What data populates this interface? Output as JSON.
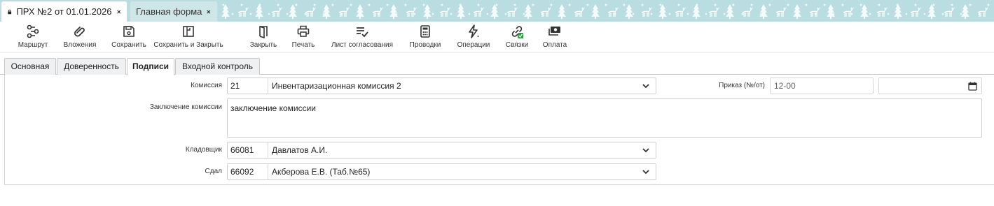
{
  "window_tabs": [
    {
      "title": "ПРХ №2 от 01.01.2026",
      "active": true
    },
    {
      "title": "Главная форма",
      "active": false
    }
  ],
  "toolbar": [
    {
      "label": "Маршрут",
      "icon": "route-icon"
    },
    {
      "label": "Вложения",
      "icon": "paperclip-icon"
    },
    {
      "label": "Сохранить",
      "icon": "save-icon"
    },
    {
      "label": "Сохранить и Закрыть",
      "icon": "save-close-icon"
    },
    {
      "label": "Закрыть",
      "icon": "door-icon"
    },
    {
      "label": "Печать",
      "icon": "printer-icon"
    },
    {
      "label": "Лист согласования",
      "icon": "approval-list-icon"
    },
    {
      "label": "Проводки",
      "icon": "calculator-icon"
    },
    {
      "label": "Операции",
      "icon": "lightning-icon"
    },
    {
      "label": "Связки",
      "icon": "link-icon"
    },
    {
      "label": "Оплата",
      "icon": "money-icon"
    }
  ],
  "form_tabs": [
    {
      "label": "Основная",
      "active": false
    },
    {
      "label": "Доверенность",
      "active": false
    },
    {
      "label": "Подписи",
      "active": true
    },
    {
      "label": "Входной контроль",
      "active": false
    }
  ],
  "form": {
    "commission": {
      "label": "Комиссия",
      "code": "21",
      "value": "Инвентаризационная комиссия 2"
    },
    "order": {
      "label": "Приказ (№/от)",
      "number": "12-00",
      "date": ""
    },
    "conclusion": {
      "label": "Заключение комиссии",
      "value": "заключение комиссии"
    },
    "storekeeper": {
      "label": "Кладовщик",
      "code": "66081",
      "value": "Давлатов А.И."
    },
    "handed_over": {
      "label": "Сдал",
      "code": "66092",
      "value": "Акберова Е.В. (Таб.№65)"
    }
  },
  "colors": {
    "accent_green": "#21a038",
    "tabbar_bg": "#b9dde0"
  }
}
